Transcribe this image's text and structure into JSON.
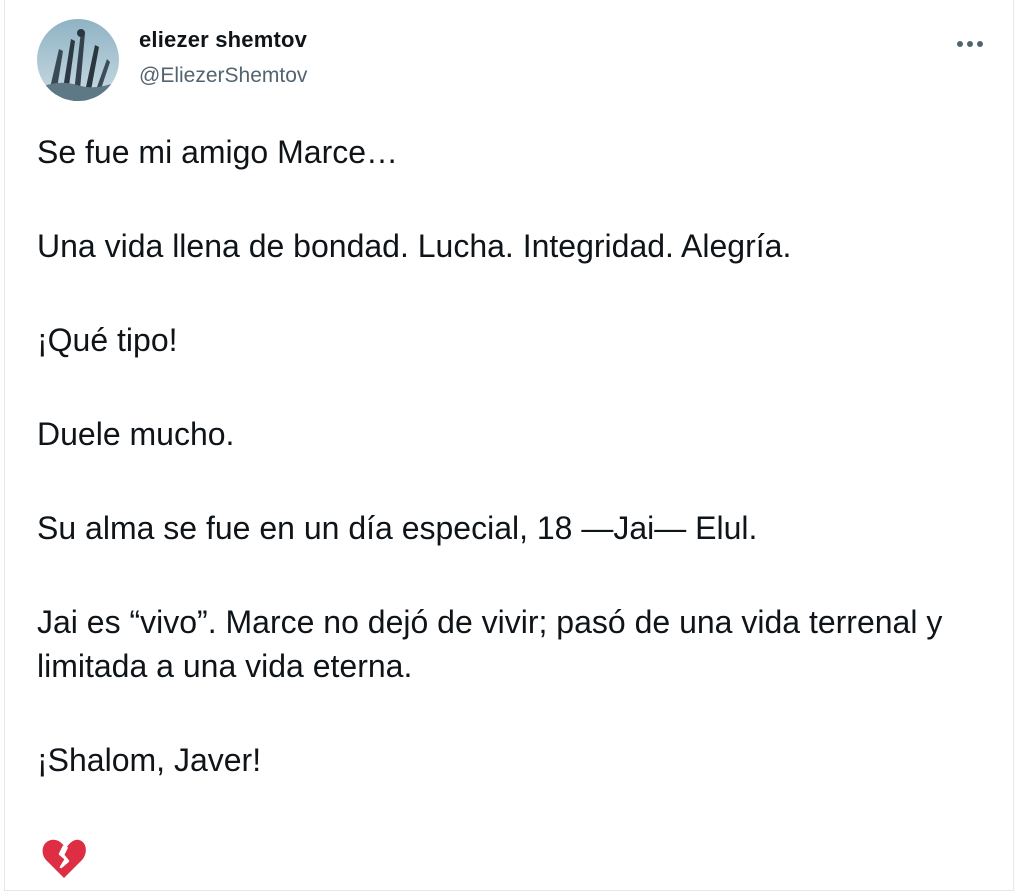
{
  "author": {
    "display_name": "eliezer shemtov",
    "handle": "@EliezerShemtov"
  },
  "more_icon": "more-horizontal-icon",
  "tweet": {
    "paragraphs": [
      "Se fue mi amigo Marce…",
      "Una vida llena de bondad. Lucha. Integridad. Alegría.",
      "¡Qué tipo!",
      "Duele mucho.",
      "Su alma se fue en un día especial, 18 —Jai— Elul.",
      "Jai es “vivo”. Marce no dejó de vivir; pasó de una vida terrenal y limitada a una vida eterna.",
      "¡Shalom, Javer!"
    ],
    "emoji": "broken-heart-icon"
  },
  "colors": {
    "text": "#0f1419",
    "secondary": "#536471",
    "emoji_red": "#dd2e44"
  }
}
